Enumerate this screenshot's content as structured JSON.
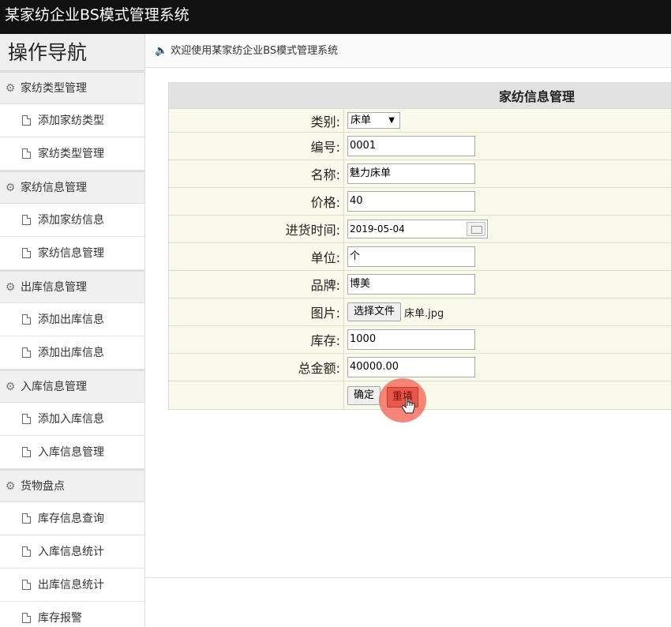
{
  "app": {
    "title": "某家纺企业BS模式管理系统",
    "welcome": "欢迎使用某家纺企业BS模式管理系统"
  },
  "sidebar": {
    "title": "操作导航",
    "groups": [
      {
        "label": "家纺类型管理",
        "items": [
          "添加家纺类型",
          "家纺类型管理"
        ]
      },
      {
        "label": "家纺信息管理",
        "items": [
          "添加家纺信息",
          "家纺信息管理"
        ]
      },
      {
        "label": "出库信息管理",
        "items": [
          "添加出库信息",
          "添加出库信息"
        ]
      },
      {
        "label": "入库信息管理",
        "items": [
          "添加入库信息",
          "入库信息管理"
        ]
      },
      {
        "label": "货物盘点",
        "items": [
          "库存信息查询",
          "入库信息统计",
          "出库信息统计",
          "库存报警"
        ]
      }
    ]
  },
  "form": {
    "title": "家纺信息管理",
    "fields": {
      "category": {
        "label": "类别:",
        "value": "床单"
      },
      "code": {
        "label": "编号:",
        "value": "0001"
      },
      "name": {
        "label": "名称:",
        "value": "魅力床单"
      },
      "price": {
        "label": "价格:",
        "value": "40"
      },
      "purchase_time": {
        "label": "进货时间:",
        "value": "2019-05-04"
      },
      "unit": {
        "label": "单位:",
        "value": "个"
      },
      "brand": {
        "label": "品牌:",
        "value": "博美"
      },
      "image": {
        "label": "图片:",
        "button": "选择文件",
        "file": "床单.jpg"
      },
      "stock": {
        "label": "库存:",
        "value": "1000"
      },
      "total": {
        "label": "总金额:",
        "value": "40000.00"
      }
    },
    "buttons": {
      "submit": "确定",
      "reset": "重填"
    }
  },
  "icons": {
    "group": "gear-icon",
    "item": "document-icon",
    "welcome": "speaker-icon",
    "date_picker": "calendar-icon",
    "cursor": "pointer-cursor-icon"
  },
  "colors": {
    "topbar": "#111111",
    "table_bg": "#f9f9ec",
    "table_header": "#e2e2e2",
    "click_highlight": "#f56455"
  }
}
